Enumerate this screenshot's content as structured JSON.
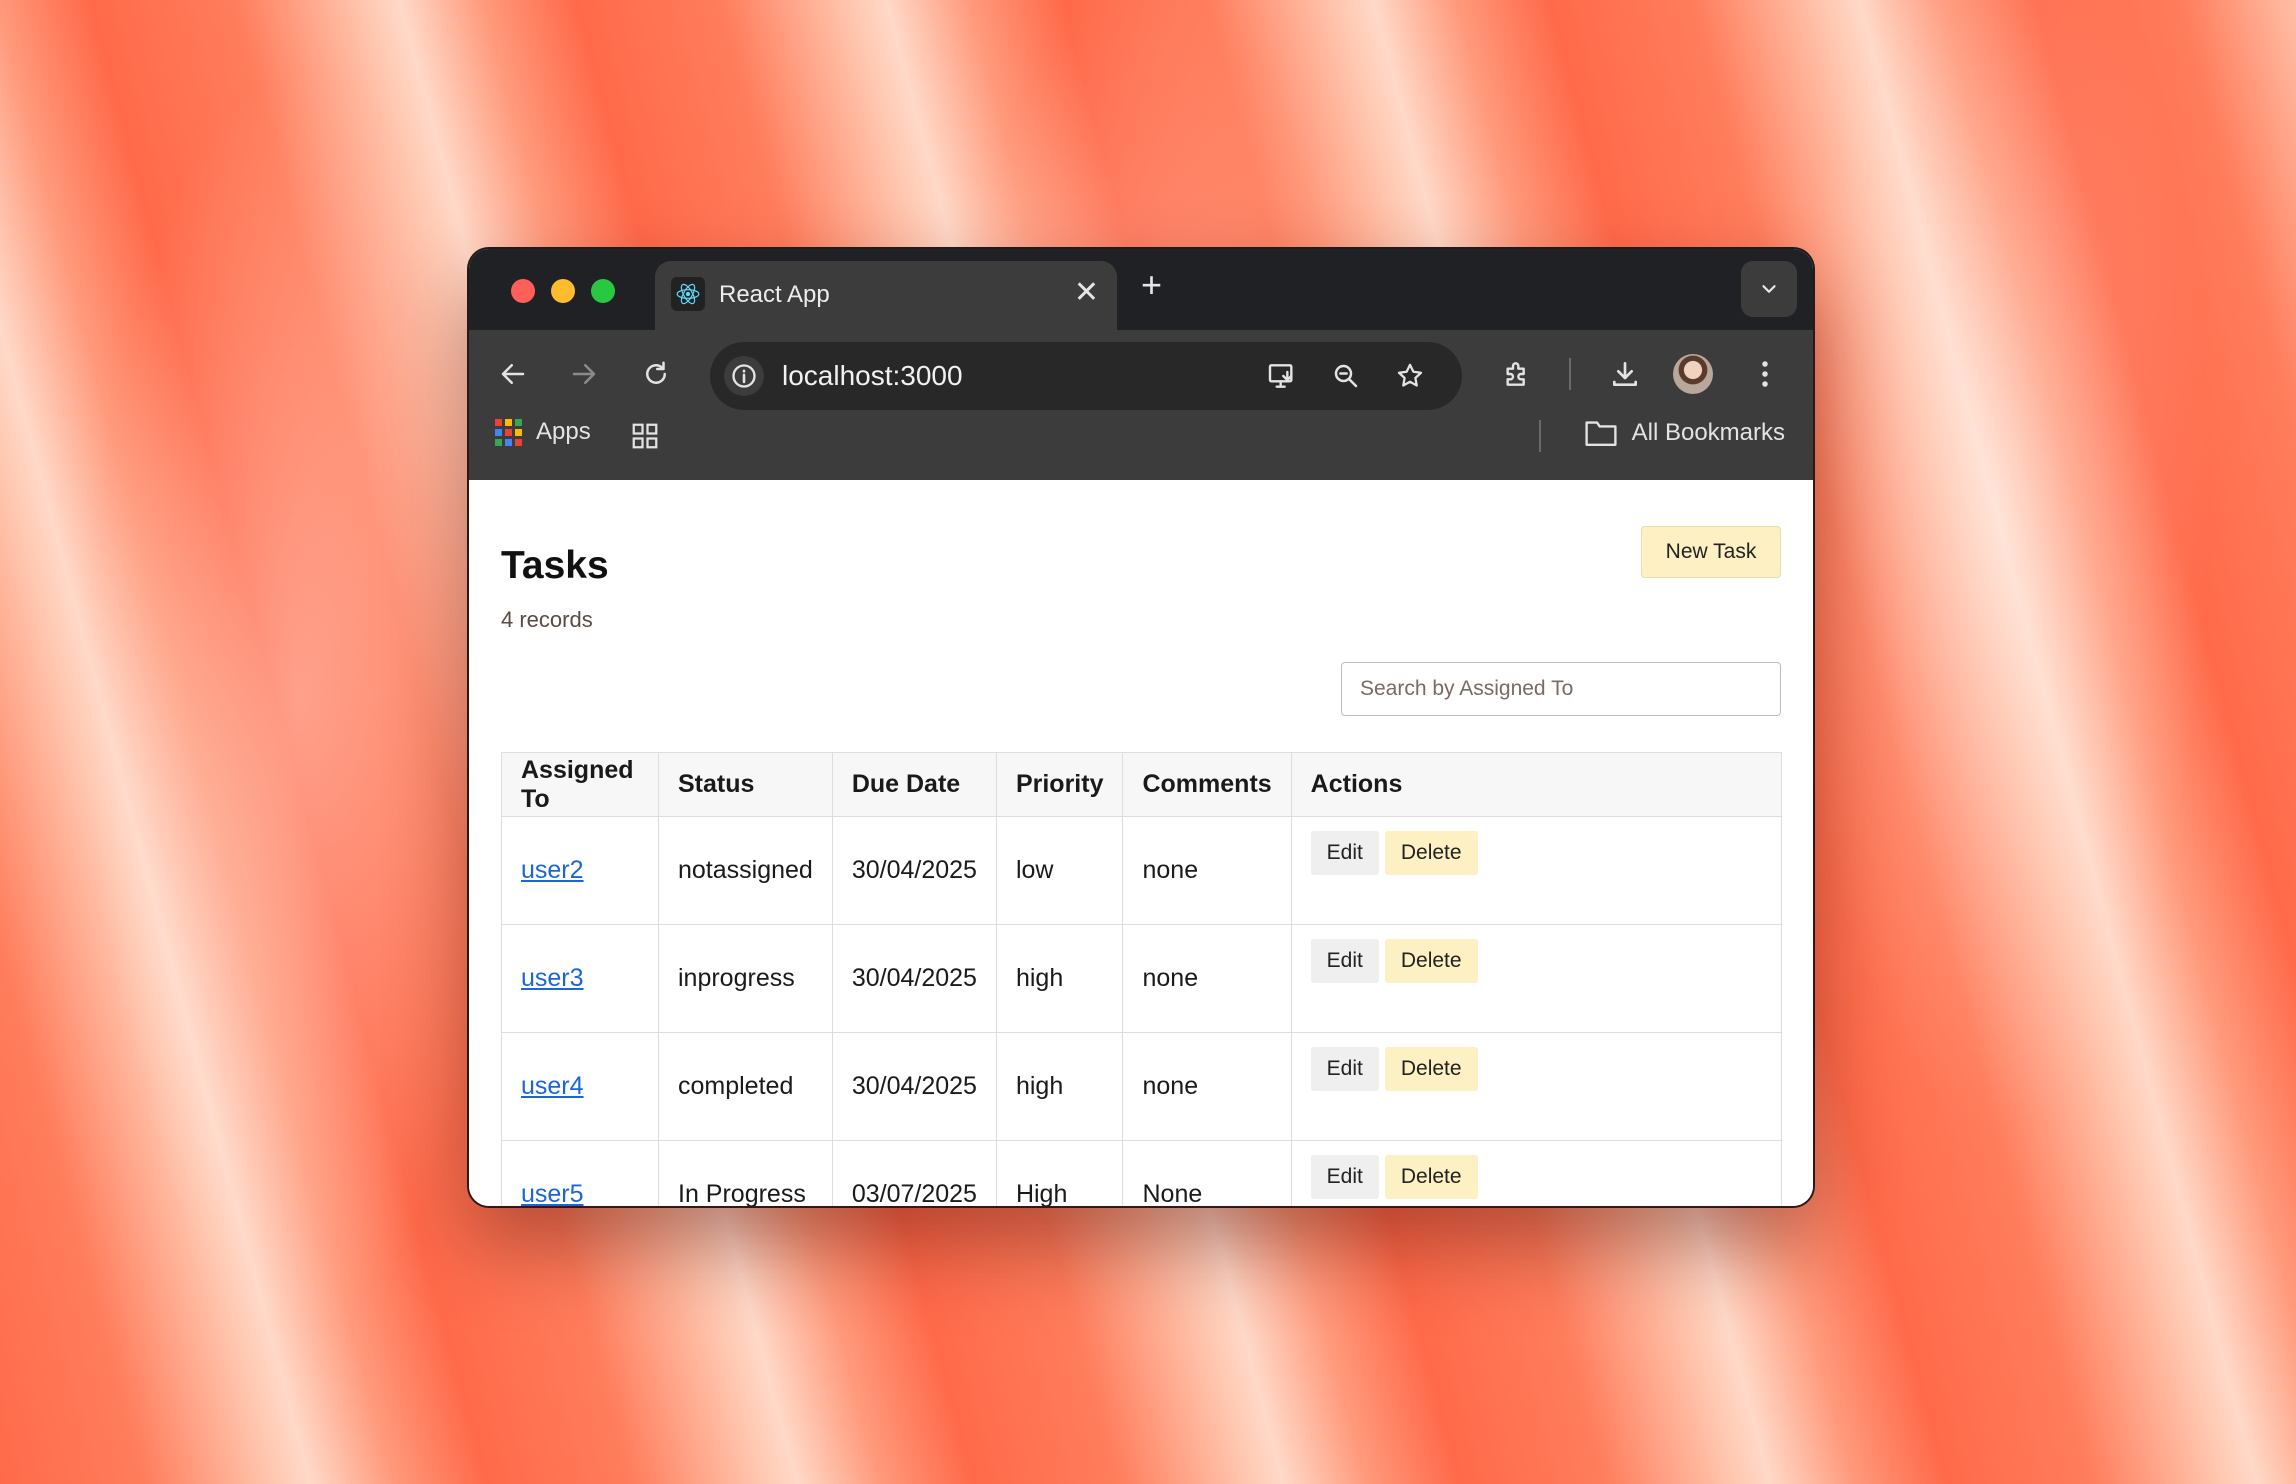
{
  "browser": {
    "tab_title": "React App",
    "tab_close": "✕",
    "new_tab": "+",
    "url": "localhost:3000",
    "bookmarks": {
      "apps_label": "Apps",
      "all_bookmarks_label": "All Bookmarks"
    }
  },
  "page": {
    "title": "Tasks",
    "record_count": "4 records",
    "new_task_label": "New Task",
    "search_placeholder": "Search by Assigned To"
  },
  "table": {
    "headers": [
      "Assigned To",
      "Status",
      "Due Date",
      "Priority",
      "Comments",
      "Actions"
    ],
    "rows": [
      {
        "assigned_to": "user2",
        "status": "notassigned",
        "due_date": "30/04/2025",
        "priority": "low",
        "comments": "none"
      },
      {
        "assigned_to": "user3",
        "status": "inprogress",
        "due_date": "30/04/2025",
        "priority": "high",
        "comments": "none"
      },
      {
        "assigned_to": "user4",
        "status": "completed",
        "due_date": "30/04/2025",
        "priority": "high",
        "comments": "none"
      },
      {
        "assigned_to": "user5",
        "status": "In Progress",
        "due_date": "03/07/2025",
        "priority": "High",
        "comments": "None"
      }
    ],
    "edit_label": "Edit",
    "delete_label": "Delete"
  },
  "colors": {
    "link": "#1a66d8",
    "new_task_bg": "#fdf0c2",
    "delete_bg": "#fdf0c2",
    "edit_bg": "#efefef",
    "browser_chrome": "#3c3c3c"
  },
  "icons": {
    "window_controls": [
      "close-light",
      "minimize-light",
      "maximize-light"
    ],
    "tab": [
      "react-favicon-icon",
      "close-icon"
    ],
    "nav": [
      "back-arrow-icon",
      "forward-arrow-icon",
      "reload-icon"
    ],
    "omnibox": [
      "site-info-icon",
      "install-app-icon",
      "zoom-icon",
      "bookmark-star-icon"
    ],
    "toolbar": [
      "extensions-icon",
      "download-icon",
      "profile-avatar",
      "more-menu-icon"
    ],
    "bookmarks": [
      "apps-grid-icon",
      "tab-groups-icon",
      "folder-icon"
    ]
  }
}
